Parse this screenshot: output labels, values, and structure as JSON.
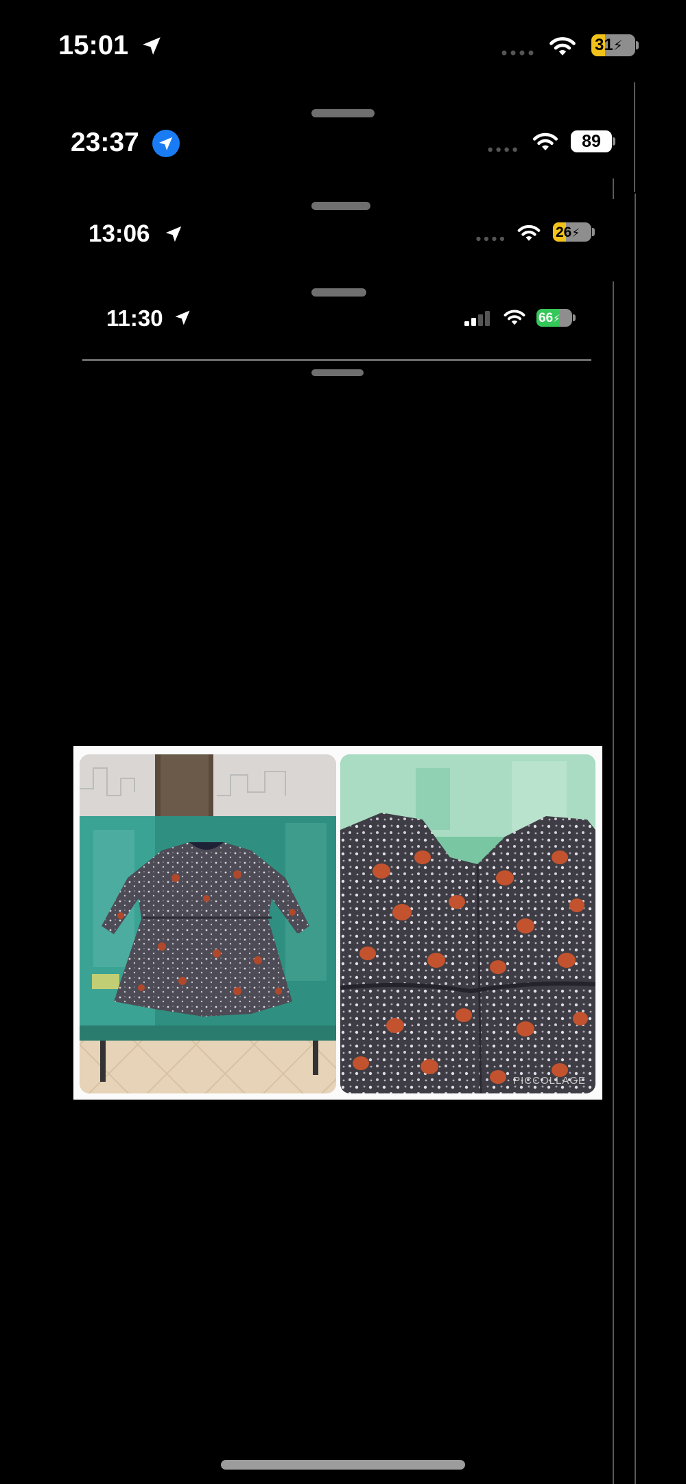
{
  "status_bars": [
    {
      "time": "15:01",
      "battery": "31",
      "battery_color": "#f2c21b",
      "location_style": "arrow"
    },
    {
      "time": "23:37",
      "battery": "89",
      "battery_color": "#ffffff",
      "location_style": "badge"
    },
    {
      "time": "13:06",
      "battery": "26",
      "battery_color": "#f2c21b",
      "location_style": "arrow"
    },
    {
      "time": "11:30",
      "battery": "66",
      "battery_color": "#34c759",
      "location_style": "arrow"
    }
  ],
  "collage": {
    "watermark": "PICCOLLAGE",
    "left_photo": "dress-on-table-photo",
    "right_photo": "dress-closeup-photo"
  },
  "colors": {
    "background": "#000000",
    "location_badge": "#1a7cf5",
    "grabber": "#6f6f6f",
    "collage_border": "#fbfbfb"
  }
}
